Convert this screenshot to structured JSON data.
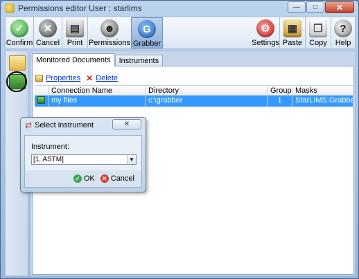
{
  "window": {
    "title": "Permissions editor User  : starlims",
    "min_glyph": "—",
    "max_glyph": "□",
    "close_glyph": "✕"
  },
  "toolbar": {
    "confirm": "Confirm",
    "cancel": "Cancel",
    "print": "Print",
    "permissions": "Permissions",
    "grabber": "Grabber",
    "settings": "Settings",
    "paste": "Paste",
    "copy": "Copy",
    "help": "Help"
  },
  "tabs": {
    "monitored": "Monitored Documents",
    "instruments": "Instruments"
  },
  "actions": {
    "properties": "Properties",
    "delete": "Delete"
  },
  "grid": {
    "columns": [
      "Connection Name",
      "Directory",
      "Groups",
      "Masks"
    ],
    "rows": [
      {
        "name": "my files",
        "directory": "c:\\grabber",
        "groups": "1",
        "masks": "StarLIMS.Grabber...."
      }
    ]
  },
  "dialog": {
    "title": "Select instrument",
    "instrument_label": "Instrument:",
    "instrument_value": "[1, ASTM]",
    "ok_label": "OK",
    "cancel_label": "Cancel"
  },
  "colors": {
    "selection": "#3399ff",
    "confirm": "#3aa84a",
    "cancel": "#d63c2f",
    "grabber": "#2b6fc4",
    "settings": "#d62d2d"
  }
}
